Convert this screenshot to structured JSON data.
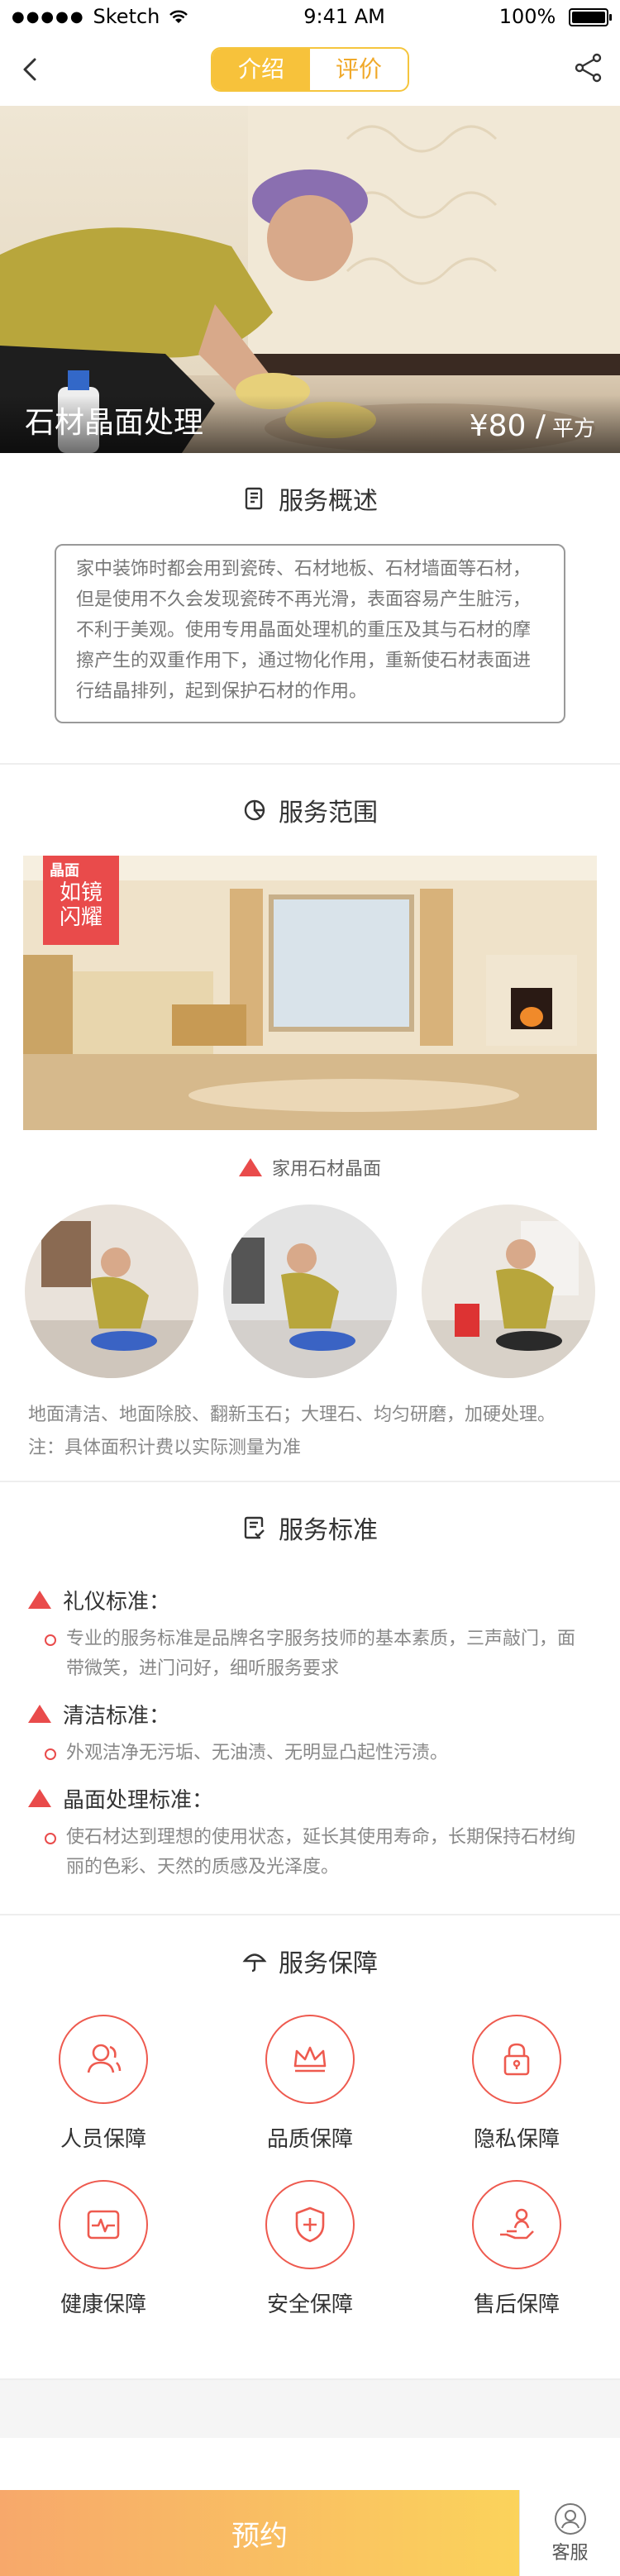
{
  "status_bar": {
    "carrier": "Sketch",
    "time": "9:41 AM",
    "battery": "100%"
  },
  "nav": {
    "tabs": [
      {
        "label": "介绍",
        "active": true
      },
      {
        "label": "评价",
        "active": false
      }
    ]
  },
  "hero": {
    "title": "石材晶面处理",
    "price": "¥80 /",
    "unit": "平方"
  },
  "overview": {
    "heading": "服务概述",
    "text": "家中装饰时都会用到瓷砖、石材地板、石材墙面等石材，但是使用不久会发现瓷砖不再光滑，表面容易产生脏污，不利于美观。使用专用晶面处理机的重压及其与石材的摩擦产生的双重作用下，通过物化作用，重新使石材表面进行结晶排列，起到保护石材的作用。"
  },
  "scope": {
    "heading": "服务范围",
    "ribbon": {
      "line1": "晶面",
      "line2": "如镜",
      "line3": "闪耀"
    },
    "caption": "家用石材晶面",
    "description": "地面清洁、地面除胶、翻新玉石；大理石、均匀研磨，加硬处理。",
    "note": "注：具体面积计费以实际测量为准"
  },
  "standards": {
    "heading": "服务标准",
    "items": [
      {
        "title": "礼仪标准：",
        "text": "专业的服务标准是品牌名字服务技师的基本素质，三声敲门，面带微笑，进门问好，细听服务要求"
      },
      {
        "title": "清洁标准：",
        "text": "外观洁净无污垢、无油渍、无明显凸起性污渍。"
      },
      {
        "title": "晶面处理标准：",
        "text": "使石材达到理想的使用状态，延长其使用寿命，长期保持石材绚丽的色彩、天然的质感及光泽度。"
      }
    ]
  },
  "guarantee": {
    "heading": "服务保障",
    "items": [
      {
        "label": "人员保障",
        "icon": "people-icon"
      },
      {
        "label": "品质保障",
        "icon": "crown-icon"
      },
      {
        "label": "隐私保障",
        "icon": "lock-icon"
      },
      {
        "label": "健康保障",
        "icon": "heartbeat-icon"
      },
      {
        "label": "安全保障",
        "icon": "shield-plus-icon"
      },
      {
        "label": "售后保障",
        "icon": "hand-person-icon"
      }
    ]
  },
  "bottom": {
    "book": "预约",
    "service": "客服"
  },
  "colors": {
    "accent_yellow": "#f7c23b",
    "accent_red": "#e94b4b",
    "icon_red": "#ee5a4f"
  }
}
